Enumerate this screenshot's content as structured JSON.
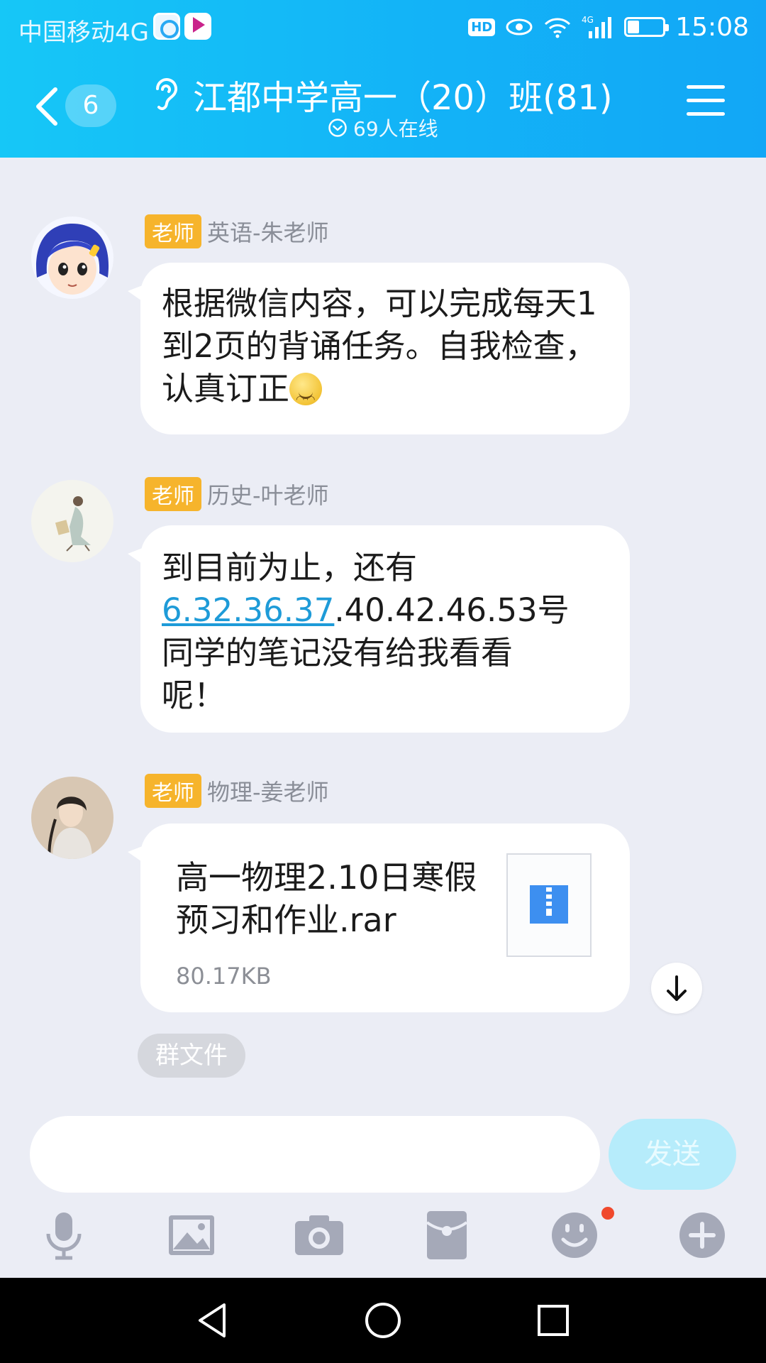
{
  "status_bar": {
    "carrier": "中国移动4G",
    "hd_badge": "HD",
    "network": "4G",
    "time": "15:08"
  },
  "header": {
    "back_count": "6",
    "title": "江都中学高一（20）班(81)",
    "online": "69人在线",
    "icons": [
      "chevron-left-icon",
      "ear-icon",
      "check-circle-icon",
      "menu-icon"
    ]
  },
  "messages": [
    {
      "tag": "老师",
      "sender": "英语-朱老师",
      "text": "根据微信内容，可以完成每天1到2页的背诵任务。自我检查，认真订正"
    },
    {
      "tag": "老师",
      "sender": "历史-叶老师",
      "link": "6.32.36.37",
      "text_rest": ".40.42.46.53号",
      "line_1": "到目前为止，还有",
      "line_3": "同学的笔记没有给我看看",
      "line_4": "呢！"
    },
    {
      "tag": "老师",
      "sender": "物理-姜老师",
      "file_name": "高一物理2.10日寒假预习和作业.rar",
      "file_size": "80.17KB"
    }
  ],
  "chip": "群文件",
  "input": {
    "value": "",
    "placeholder": ""
  },
  "send_label": "发送",
  "toolbar": [
    "microphone-icon",
    "image-icon",
    "camera-icon",
    "red-packet-icon",
    "emoji-icon",
    "plus-icon"
  ],
  "colors": {
    "header": "#13b3f7",
    "tag": "#f6b42c",
    "link": "#1e9bd8",
    "send": "#b6ecfb",
    "background": "#ebedf5"
  }
}
